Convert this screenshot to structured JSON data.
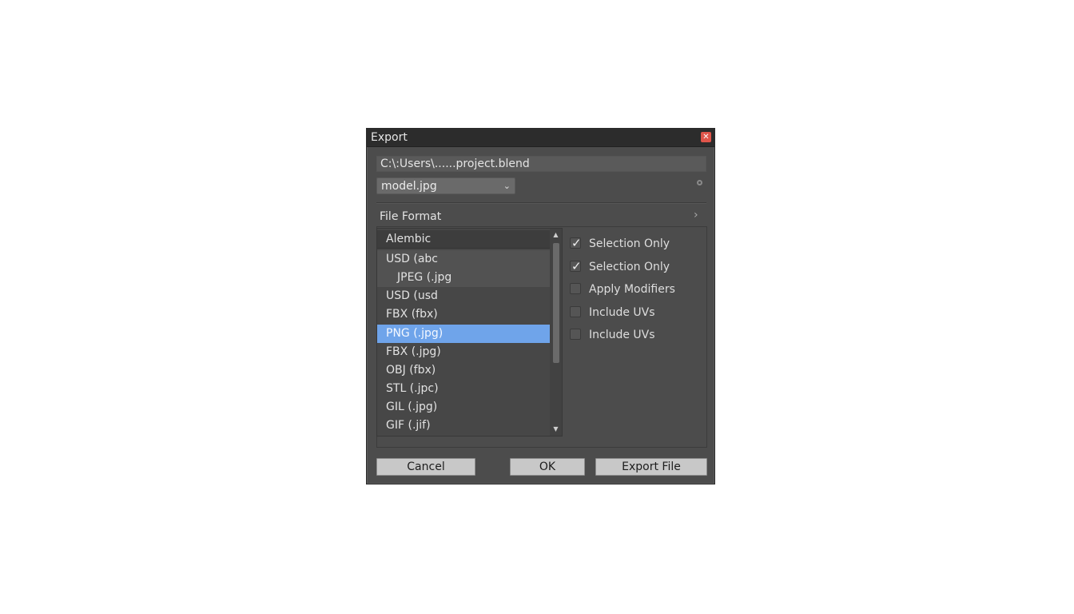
{
  "dialog": {
    "title": "Export",
    "close_symbol": "✕"
  },
  "file": {
    "path": "C:\\:Users\\......project.blend",
    "filename": "model.jpg",
    "filename_chevron": "⌄"
  },
  "file_format": {
    "label": "File Format",
    "chevron": "›",
    "items": [
      {
        "label": "Alembic"
      },
      {
        "label": "USD (abc"
      },
      {
        "label": "JPEG (.jpg"
      },
      {
        "label": "USD (usd"
      },
      {
        "label": "FBX (fbx)"
      },
      {
        "label": "PNG (.jpg)"
      },
      {
        "label": "FBX (.jpg)"
      },
      {
        "label": "OBJ (fbx)"
      },
      {
        "label": "STL (.jpc)"
      },
      {
        "label": "GIL (.jpg)"
      },
      {
        "label": "GIF (.jif)"
      }
    ],
    "selected_index": 5,
    "scroll_up": "▲",
    "scroll_down": "▼"
  },
  "options": [
    {
      "label": "Selection Only",
      "checked": true
    },
    {
      "label": "Selection Only",
      "checked": true
    },
    {
      "label": "Apply Modifiers",
      "checked": false
    },
    {
      "label": "Include UVs",
      "checked": false
    },
    {
      "label": "Include UVs",
      "checked": false
    }
  ],
  "checkmark": "✓",
  "buttons": {
    "cancel": "Cancel",
    "ok": "OK",
    "export": "Export File"
  },
  "colors": {
    "selection": "#6fa4ea",
    "dialog_bg": "#4c4c4c",
    "close": "#e0554a"
  }
}
